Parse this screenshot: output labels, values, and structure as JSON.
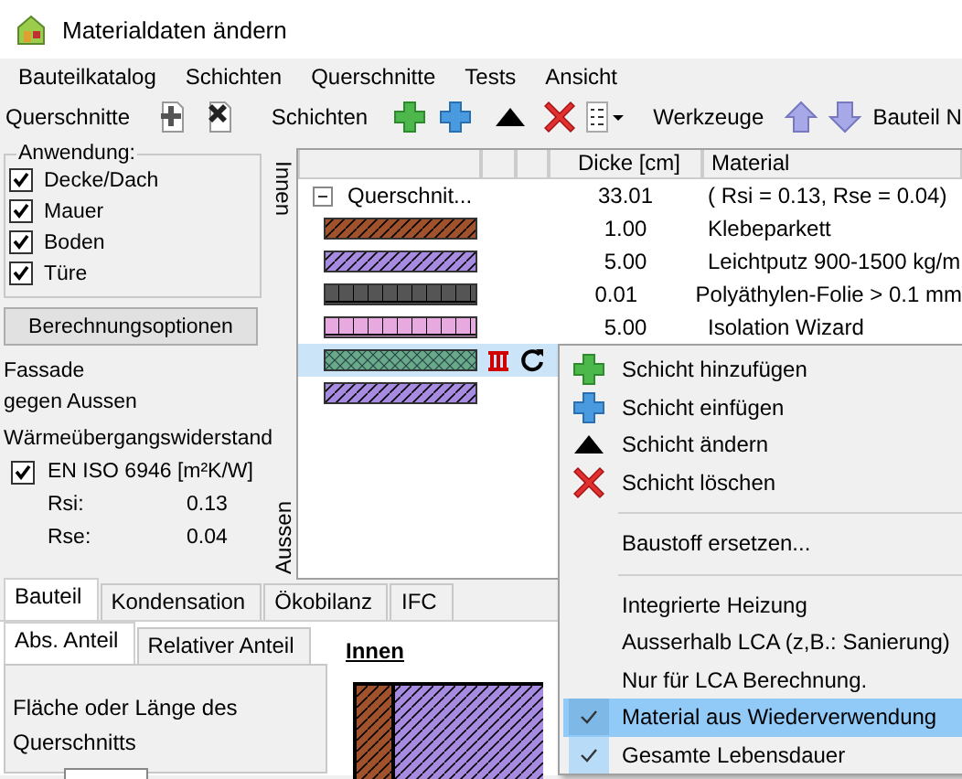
{
  "window": {
    "title": "Materialdaten ändern"
  },
  "menu": [
    "Bauteilkatalog",
    "Schichten",
    "Querschnitte",
    "Tests",
    "Ansicht"
  ],
  "toolbar": {
    "sections_label": "Querschnitte",
    "layers_label": "Schichten",
    "tools_label": "Werkzeuge",
    "component_label": "Bauteil N"
  },
  "application": {
    "title": "Anwendung:",
    "items": [
      {
        "label": "Decke/Dach",
        "checked": true
      },
      {
        "label": "Mauer",
        "checked": true
      },
      {
        "label": "Boden",
        "checked": true
      },
      {
        "label": "Türe",
        "checked": true
      }
    ]
  },
  "calc_button": "Berechnungsoptionen",
  "info": [
    "Fassade",
    "gegen Aussen"
  ],
  "resistance": {
    "title": "Wärmeübergangswiderstand",
    "standard": {
      "label": "EN ISO 6946  [m²K/W]",
      "checked": true
    },
    "values": [
      {
        "label": "Rsi:",
        "value": "0.13"
      },
      {
        "label": "Rse:",
        "value": "0.04"
      }
    ]
  },
  "side_labels": {
    "inner": "Innen",
    "outer": "Aussen"
  },
  "grid": {
    "columns": [
      "Dicke [cm]",
      "Material"
    ],
    "cross_section": {
      "label": "Querschnit...",
      "expanded": true,
      "thickness": "33.01",
      "material": "( Rsi = 0.13, Rse = 0.04)"
    },
    "layers": [
      {
        "kind": "diagonal",
        "color": "#a0522d",
        "thickness": "1.00",
        "material": "Klebeparkett",
        "selected": false,
        "heating": false,
        "reuse": false
      },
      {
        "kind": "diagonal",
        "color": "#a78be0",
        "thickness": "5.00",
        "material": "Leichtputz 900-1500 kg/m",
        "selected": false,
        "heating": false,
        "reuse": false
      },
      {
        "kind": "blocks",
        "color": "#555555",
        "thickness": "0.01",
        "material": "Polyäthylen-Folie > 0.1 mm",
        "selected": false,
        "heating": false,
        "reuse": false
      },
      {
        "kind": "blocks",
        "color": "#e8a8e0",
        "thickness": "5.00",
        "material": "Isolation Wizard",
        "selected": false,
        "heating": false,
        "reuse": false
      },
      {
        "kind": "crosshatch",
        "color": "#6aa88a",
        "selected": true,
        "heating": true,
        "reuse": true
      },
      {
        "kind": "diagonal",
        "color": "#a78be0",
        "selected": false,
        "heating": false,
        "reuse": false
      }
    ]
  },
  "tabs": [
    {
      "label": "Bauteil",
      "selected": true
    },
    {
      "label": "Kondensation",
      "selected": false
    },
    {
      "label": "Ökobilanz",
      "selected": false
    },
    {
      "label": "IFC",
      "selected": false
    }
  ],
  "subtabs": [
    {
      "label": "Abs. Anteil",
      "selected": true
    },
    {
      "label": "Relativer Anteil",
      "selected": false
    }
  ],
  "area_label": "Fläche oder Länge des Querschnitts",
  "drawing_label": "Innen",
  "context_menu": [
    {
      "kind": "action",
      "label": "Schicht hinzufügen"
    },
    {
      "kind": "action",
      "label": "Schicht einfügen"
    },
    {
      "kind": "action",
      "label": "Schicht ändern"
    },
    {
      "kind": "action",
      "label": "Schicht löschen"
    },
    {
      "kind": "separator"
    },
    {
      "kind": "item",
      "label": "Baustoff ersetzen...",
      "checked": false,
      "selected": false
    },
    {
      "kind": "separator"
    },
    {
      "kind": "item",
      "label": "Integrierte Heizung",
      "checked": false,
      "selected": false
    },
    {
      "kind": "item",
      "label": "Ausserhalb LCA (z,B.: Sanierung)",
      "checked": false,
      "selected": false
    },
    {
      "kind": "item",
      "label": "Nur für LCA Berechnung.",
      "checked": false,
      "selected": false
    },
    {
      "kind": "item",
      "label": "Material aus Wiederverwendung",
      "checked": true,
      "selected": true
    },
    {
      "kind": "item",
      "label": "Gesamte Lebensdauer",
      "checked": true,
      "selected": false
    }
  ]
}
